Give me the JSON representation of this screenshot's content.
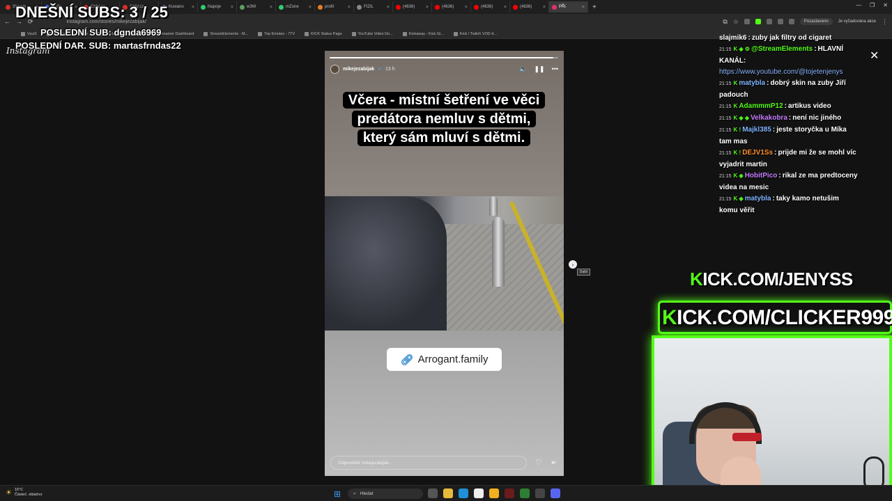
{
  "overlay": {
    "subs_today": "DNEŠNÍ SUBS: 3 / 25",
    "last_sub": "POSLEDNÍ SUB: dgnda6969",
    "last_gift_sub": "POSLEDNÍ DAR. SUB: martasfrndas22"
  },
  "browser": {
    "tabs": [
      {
        "label": "Stream",
        "color": "#d93025"
      },
      {
        "label": "Betfe",
        "color": "#3b6cff"
      },
      {
        "label": "CtrlV.cz",
        "color": "#d93025"
      },
      {
        "label": "CtrlV.cz",
        "color": "#d93025"
      },
      {
        "label": "Kuwano",
        "color": "#9b59b6"
      },
      {
        "label": "Napoje",
        "color": "#2ecc71"
      },
      {
        "label": "w3W",
        "color": "#5f9f5f"
      },
      {
        "label": "mZone",
        "color": "#2ecc71"
      },
      {
        "label": "profil",
        "color": "#e67e22"
      },
      {
        "label": "FIZIL",
        "color": "#888888"
      },
      {
        "label": "(4636)",
        "color": "#ff0000"
      },
      {
        "label": "(4636)",
        "color": "#ff0000"
      },
      {
        "label": "(4636)",
        "color": "#ff0000"
      },
      {
        "label": "(4636)",
        "color": "#ff0000"
      },
      {
        "label": "PŘi",
        "color": "#e1306c"
      }
    ],
    "new_tab": "+",
    "url": "instagram.com/stories/mikejezabijak/",
    "profile_label": "Pozastaveno",
    "profile_note": "Je vyžadována akce",
    "bookmarks": [
      "Vyučt",
      "File Converter - Free",
      "The best ChatBot an...",
      "Streamer Dashboard",
      "StreamElements - M...",
      "Top Emotes - 7TV",
      "KICK Status Page",
      "YouTube Video Do...",
      "Kickaway - Kick Gi...",
      "Kick / Twitch VOD d..."
    ]
  },
  "instagram": {
    "logo": "Instagram",
    "story": {
      "progress": 0.98,
      "username": "mikejezabijak",
      "verified_icon": "verified-badge-icon",
      "time_ago": "13 h",
      "caption": "Včera - místní šetření ve věci predátora nemluv s dětmi, který sám mluví s dětmi.",
      "link_label": "Arrogant.family",
      "reply_placeholder": "Odpovědět mikejezabijak...",
      "next_tooltip": "Další"
    }
  },
  "chat": {
    "messages": [
      {
        "time": "",
        "badges": "",
        "user": "slajmik6",
        "color": "#ffffff",
        "text": "zuby jak filtry od cigaret"
      },
      {
        "time": "21:15",
        "badges": "K ◈ ⚙",
        "user": "@StreamElements",
        "color": "#53fc18",
        "text": "HLAVNÍ KANÁL:",
        "link": "https://www.youtube.com/@tojetenjenys"
      },
      {
        "time": "21:15",
        "badges": "K",
        "user": "matybla",
        "color": "#7fb3ff",
        "text": "dobrý skin na zuby Jiří padouch"
      },
      {
        "time": "21:15",
        "badges": "K",
        "user": "AdammmP12",
        "color": "#53fc18",
        "text": "artikus video"
      },
      {
        "time": "21:15",
        "badges": "K ◈ ◈",
        "user": "Velkakobra",
        "color": "#c77dff",
        "text": "není nic jiného"
      },
      {
        "time": "21:15",
        "badges": "K !",
        "user": "Majkl385",
        "color": "#7fb3ff",
        "text": "jeste storyčka u Míka tam mas"
      },
      {
        "time": "21:15",
        "badges": "K !",
        "user": "DEJV1Ss",
        "color": "#ff8c2b",
        "text": "prijde mi že se mohl víc vyjadrit martin"
      },
      {
        "time": "21:15",
        "badges": "K ◈",
        "user": "HobitPico",
        "color": "#c77dff",
        "text": "rikal ze ma predtoceny videa na mesic"
      },
      {
        "time": "21:15",
        "badges": "K ◈",
        "user": "matybla",
        "color": "#7fb3ff",
        "text": "taky kamo netušim komu věřit"
      }
    ]
  },
  "kick": {
    "banner1_k": "K",
    "banner1_rest": "ICK.COM/JENYSS",
    "banner2_k": "K",
    "banner2_rest": "ICK.COM/CLICKER999"
  },
  "taskbar": {
    "temp": "16°C",
    "weather": "Částeč. oblačno",
    "search_label": "Hledat"
  },
  "colors": {
    "kick_green": "#53fc18"
  }
}
